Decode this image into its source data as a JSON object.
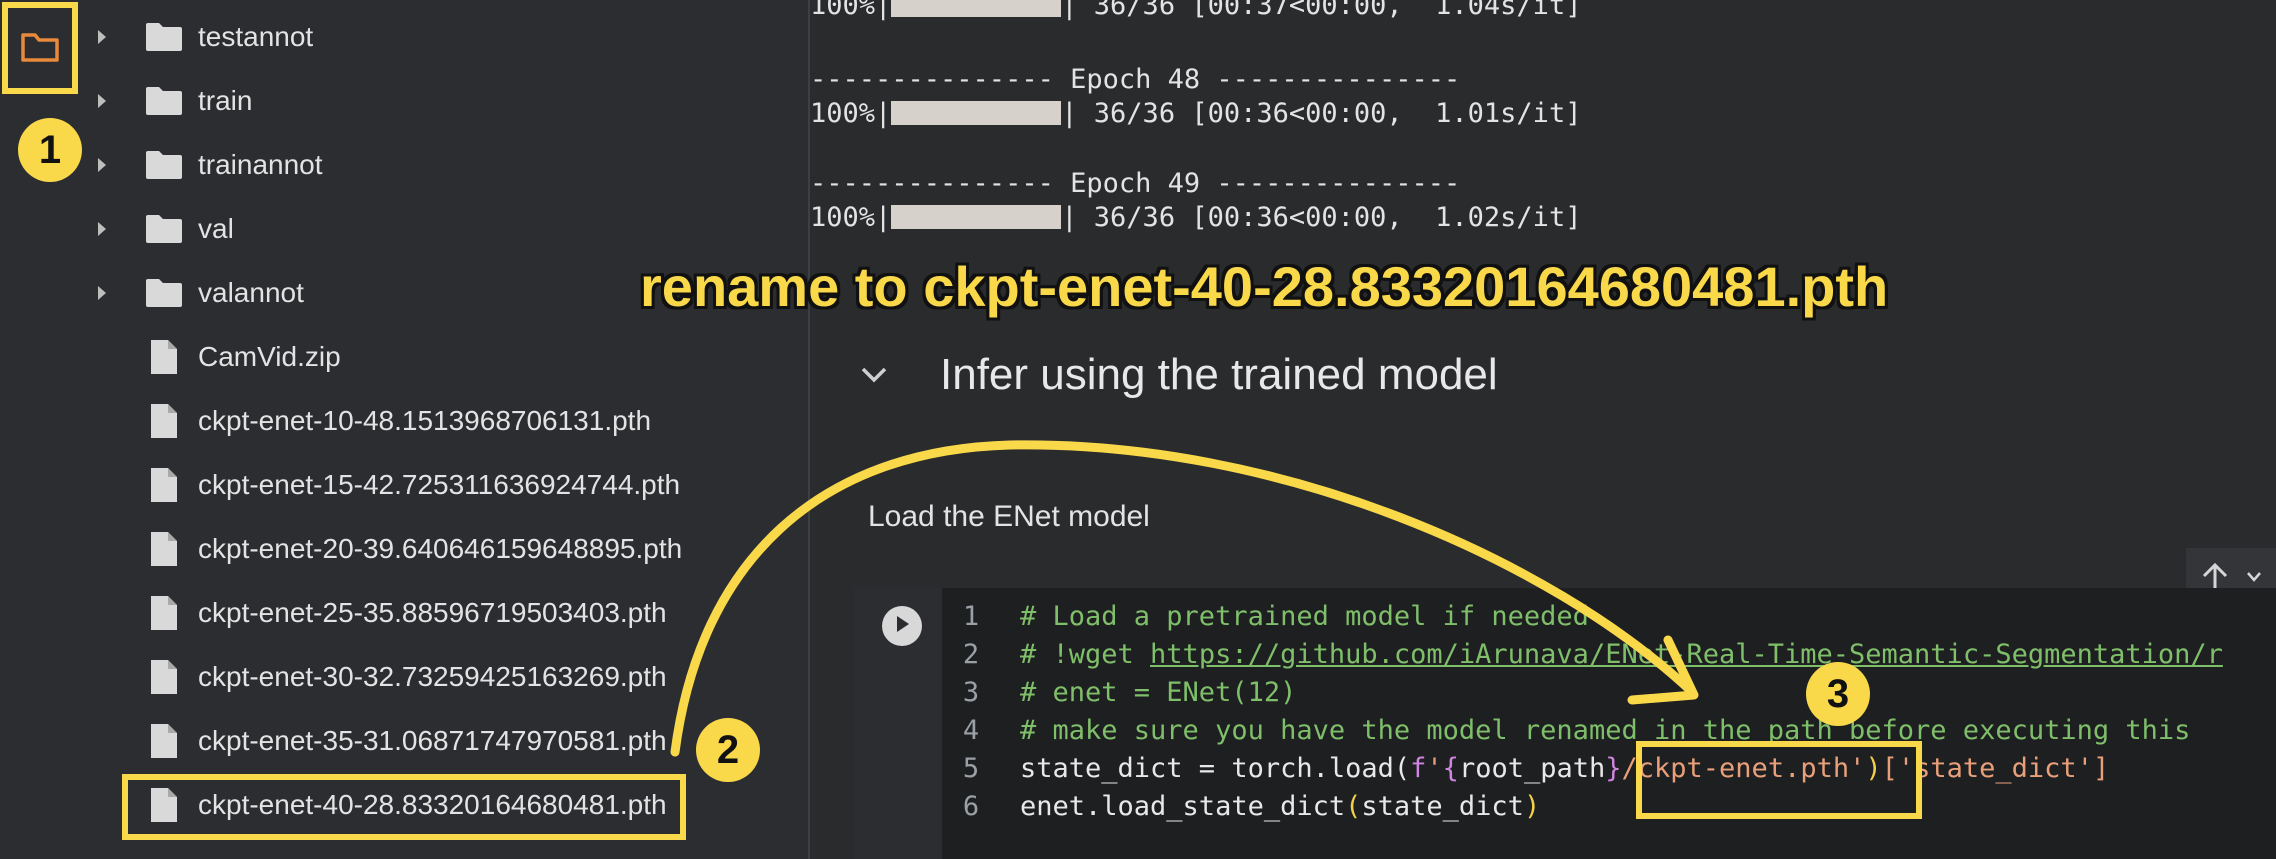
{
  "sidebar": {
    "tree": [
      {
        "type": "folder",
        "label": "testannot"
      },
      {
        "type": "folder",
        "label": "train"
      },
      {
        "type": "folder",
        "label": "trainannot"
      },
      {
        "type": "folder",
        "label": "val"
      },
      {
        "type": "folder",
        "label": "valannot"
      },
      {
        "type": "file",
        "label": "CamVid.zip"
      },
      {
        "type": "file",
        "label": "ckpt-enet-10-48.1513968706131.pth"
      },
      {
        "type": "file",
        "label": "ckpt-enet-15-42.725311636924744.pth"
      },
      {
        "type": "file",
        "label": "ckpt-enet-20-39.640646159648895.pth"
      },
      {
        "type": "file",
        "label": "ckpt-enet-25-35.88596719503403.pth"
      },
      {
        "type": "file",
        "label": "ckpt-enet-30-32.73259425163269.pth"
      },
      {
        "type": "file",
        "label": "ckpt-enet-35-31.06871747970581.pth"
      },
      {
        "type": "file",
        "label": "ckpt-enet-40-28.83320164680481.pth"
      }
    ]
  },
  "output": {
    "line1_pct": "100%|",
    "line1_rest": "| 36/36 [00:37<00:00,  1.04s/it]",
    "epoch48": "--------------- Epoch 48 ---------------",
    "line2_pct": "100%|",
    "line2_rest": "| 36/36 [00:36<00:00,  1.01s/it]",
    "epoch49": "--------------- Epoch 49 ---------------",
    "line3_pct": "100%|",
    "line3_rest": "| 36/36 [00:36<00:00,  1.02s/it]"
  },
  "section_title": "Infer using the trained model",
  "text_cell": "Load the ENet model",
  "code": {
    "line_numbers": [
      "1",
      "2",
      "3",
      "4",
      "5",
      "6"
    ],
    "l1": "# Load a pretrained model if needed",
    "l2_a": "# !wget ",
    "l2_link": "https://github.com/iArunava/ENet-Real-Time-Semantic-Segmentation/r",
    "l3": "# enet = ENet(12)",
    "l4": "# make sure you have the model renamed in the path before executing this",
    "l5_a": "state_dict = torch.load(",
    "l5_f": "f",
    "l5_q1": "'",
    "l5_b1": "{",
    "l5_var": "root_path",
    "l5_b2": "}",
    "l5_path": "/ckpt-enet.pth",
    "l5_q2": "'",
    "l5_close": ")",
    "l5_key": "['state_dict']",
    "l6_a": "enet.load_state_dict",
    "l6_p1": "(",
    "l6_arg": "state_dict",
    "l6_p2": ")"
  },
  "annotations": {
    "badge1": "1",
    "badge2": "2",
    "badge3": "3",
    "caption": "rename to ckpt-enet-40-28.83320164680481.pth"
  },
  "colors": {
    "accent": "#f9d94a",
    "folder_icon": "#e8893b"
  }
}
